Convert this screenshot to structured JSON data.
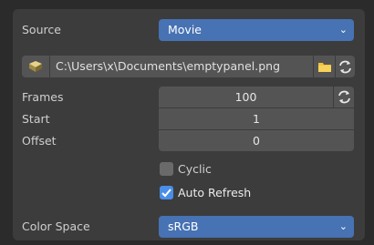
{
  "source": {
    "label": "Source",
    "value": "Movie"
  },
  "file": {
    "path": "C:\\Users\\x\\Documents\\emptypanel.png"
  },
  "frames": {
    "label": "Frames",
    "value": "100"
  },
  "start": {
    "label": "Start",
    "value": "1"
  },
  "offset": {
    "label": "Offset",
    "value": "0"
  },
  "cyclic": {
    "label": "Cyclic",
    "checked": false
  },
  "auto_refresh": {
    "label": "Auto Refresh",
    "checked": true
  },
  "color_space": {
    "label": "Color Space",
    "value": "sRGB"
  },
  "colors": {
    "accent": "#4772b3",
    "panel": "#3c3c3c",
    "field": "#545454",
    "checkbox_on": "#4a8ee8"
  }
}
